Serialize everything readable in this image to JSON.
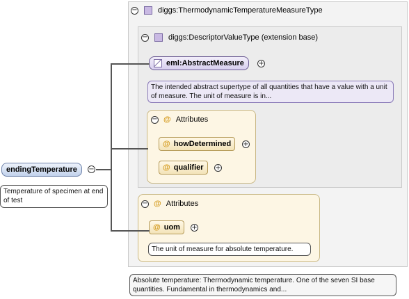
{
  "type": {
    "name": "diggs:ThermodynamicTemperatureMeasureType",
    "doc": "Absolute temperature: Thermodynamic temperature. One of the seven SI base quantities. Fundamental in thermodynamics and..."
  },
  "base": {
    "name": "diggs:DescriptorValueType (extension base)"
  },
  "abstract_measure": {
    "label": "eml:AbstractMeasure",
    "doc": "The intended abstract supertype of all quantities that have a value with a unit of measure. The unit of measure is in..."
  },
  "inner_attributes": {
    "title": "Attributes",
    "items": [
      {
        "label": "howDetermined"
      },
      {
        "label": "qualifier"
      }
    ]
  },
  "outer_attributes": {
    "title": "Attributes",
    "items": [
      {
        "label": "uom",
        "doc": "The unit of measure for absolute temperature."
      }
    ]
  },
  "root": {
    "label": "endingTemperature",
    "doc": "Temperature of specimen at end of test"
  },
  "icons": {
    "collapse": "⊖",
    "expand": "⊕",
    "attribute": "@"
  }
}
